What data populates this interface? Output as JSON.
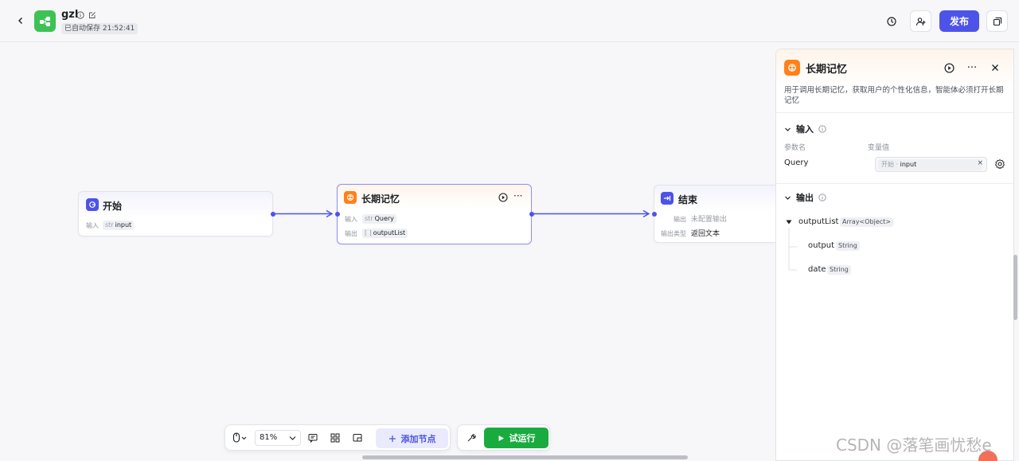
{
  "header": {
    "app_name": "gzl",
    "save_status": "已自动保存 21:52:41",
    "publish_label": "发布"
  },
  "nodes": {
    "start": {
      "title": "开始",
      "input_label": "输入",
      "input_type": "str",
      "input_value": "input"
    },
    "memory": {
      "title": "长期记忆",
      "input_label": "输入",
      "input_type": "str",
      "input_value": "Query",
      "output_label": "输出",
      "output_type": "[ ]",
      "output_value": "outputList"
    },
    "end": {
      "title": "结束",
      "output_label": "输出",
      "output_value": "未配置输出",
      "output_type_label": "输出类型",
      "output_type_value": "返回文本"
    }
  },
  "panel": {
    "title": "长期记忆",
    "description": "用于调用长期记忆，获取用户的个性化信息，智能体必须打开长期记忆",
    "input_section": "输入",
    "param_name_header": "参数名",
    "var_value_header": "变量值",
    "param_name": "Query",
    "var_source": "开始",
    "var_value": "input",
    "output_section": "输出",
    "outputs": [
      {
        "name": "outputList",
        "type": "Array<Object>"
      },
      {
        "name": "output",
        "type": "String"
      },
      {
        "name": "date",
        "type": "String"
      }
    ]
  },
  "toolbar": {
    "zoom": "81%",
    "add_node_label": "添加节点",
    "run_label": "试运行"
  },
  "watermark": "CSDN @落笔画忧愁e",
  "colors": {
    "accent": "#4d53e8",
    "memory_icon": "#ff811a",
    "run_green": "#1aab3f",
    "logo_green": "#3ec254"
  }
}
